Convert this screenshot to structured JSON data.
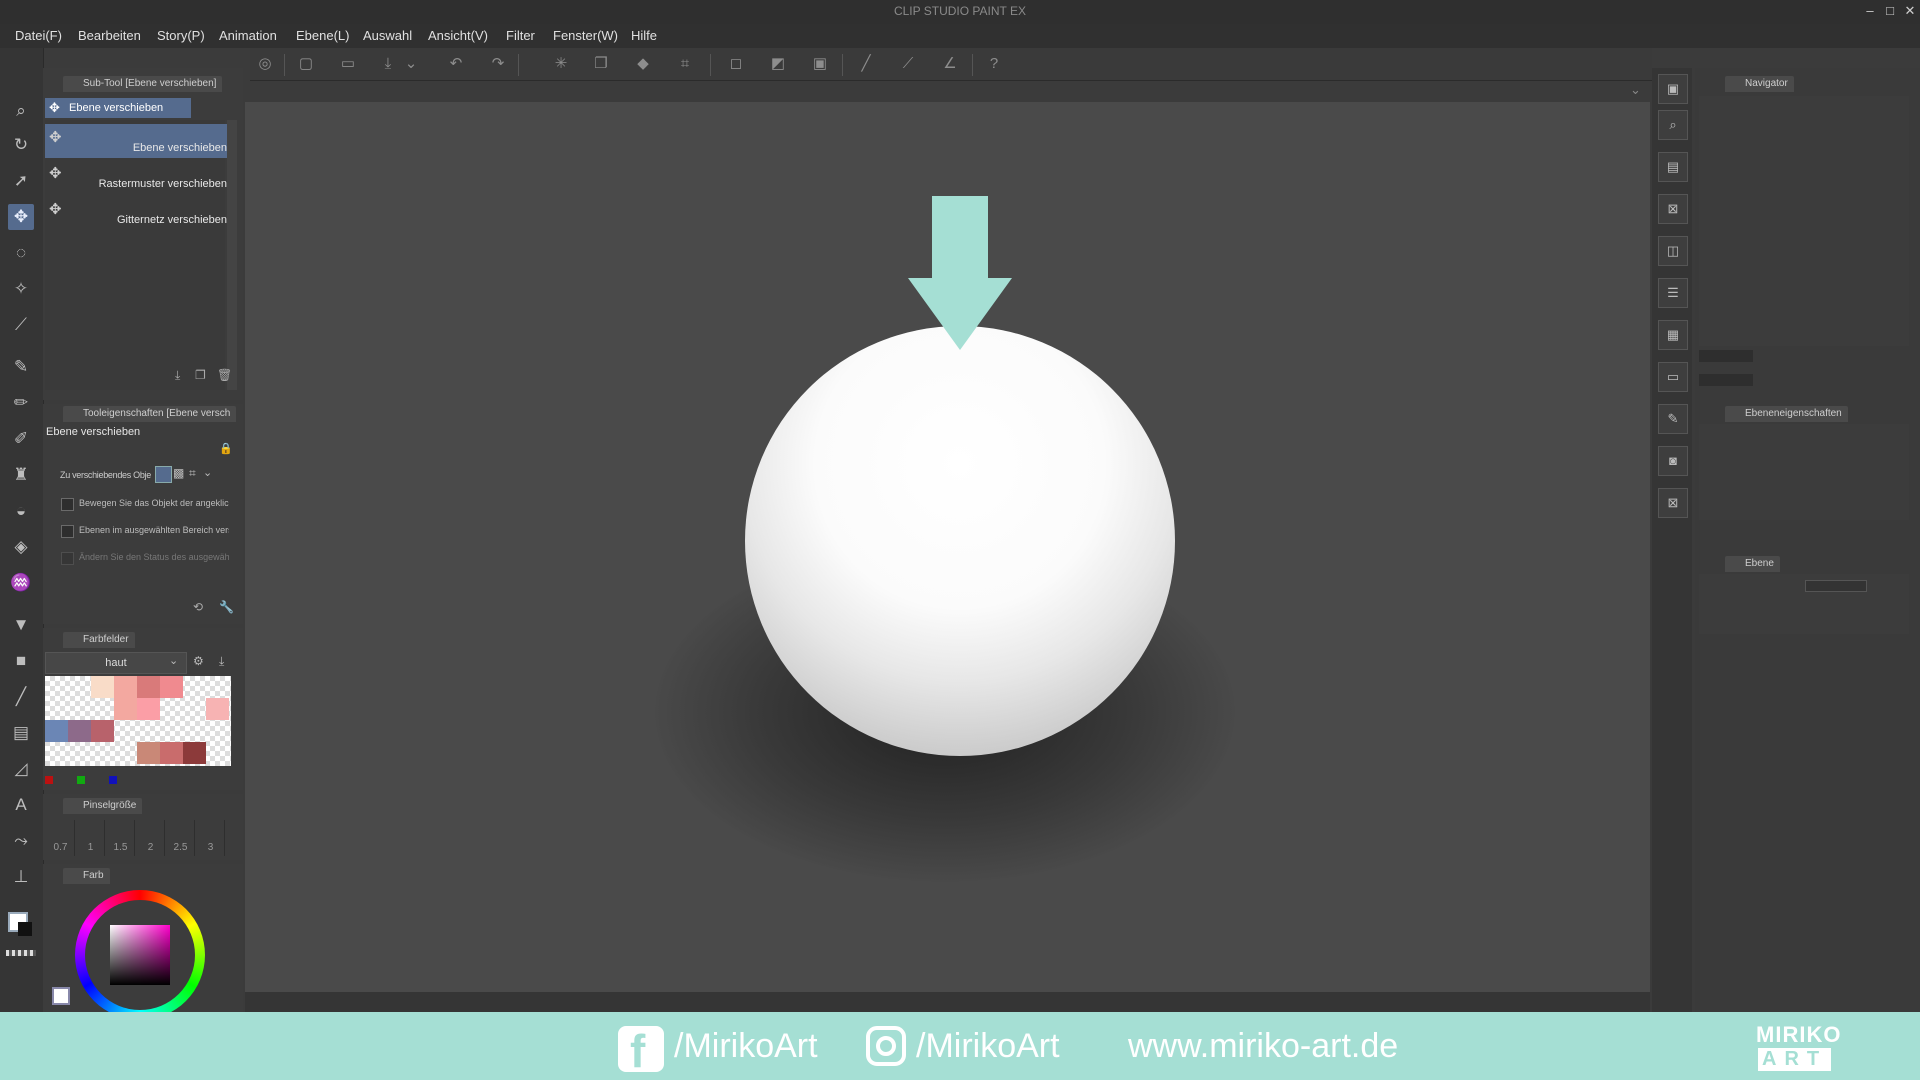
{
  "window": {
    "title": "CLIP STUDIO PAINT EX"
  },
  "menu": [
    "Datei(F)",
    "Bearbeiten",
    "Story(P)",
    "Animation",
    "Ebene(L)",
    "Auswahl",
    "Ansicht(V)",
    "Filter",
    "Fenster(W)",
    "Hilfe"
  ],
  "subtool": {
    "tab": "Sub-Tool [Ebene verschieben]",
    "group": "Ebene verschieben",
    "items": [
      "Ebene verschieben",
      "Rastermuster verschieben",
      "Gitternetz verschieben"
    ]
  },
  "toolprops": {
    "tab": "Tooleigenschaften [Ebene versch",
    "title": "Ebene verschieben",
    "object_label": "Zu verschiebendes Obje",
    "options": [
      "Bewegen Sie das Objekt der angeklickter",
      "Ebenen im ausgewählten Bereich versch",
      "Ändern Sie den Status des ausgewähler"
    ]
  },
  "swatches": {
    "tab": "Farbfelder",
    "set": "haut",
    "colors": [
      "#f9dcc8",
      "#f3a8a0",
      "#d97a7a",
      "#f08a8f",
      "#f7b3b3",
      "#f3a8a0",
      "#fb9ea6",
      "#6b86b5",
      "#8d6a8a",
      "#b8626b",
      "#c98877",
      "#c96c6c",
      "#8c3a3a"
    ]
  },
  "brushsize": {
    "tab": "Pinselgröße",
    "values": [
      "0.7",
      "1",
      "1.5",
      "2",
      "2.5",
      "3"
    ]
  },
  "colorpanel": {
    "tab": "Farb"
  },
  "navigator": {
    "tab": "Navigator"
  },
  "layerprops": {
    "tab": "Ebeneneigenschaften"
  },
  "layer": {
    "tab": "Ebene"
  },
  "footer": {
    "facebook": "/MirikoArt",
    "instagram": "/MirikoArt",
    "website": "www.miriko-art.de",
    "logo_top": "MIRIKO",
    "logo_bottom": "ART"
  },
  "colors": {
    "accent": "#556b8e",
    "arrow": "#a5dfd4",
    "footer": "#a5dfd4"
  }
}
